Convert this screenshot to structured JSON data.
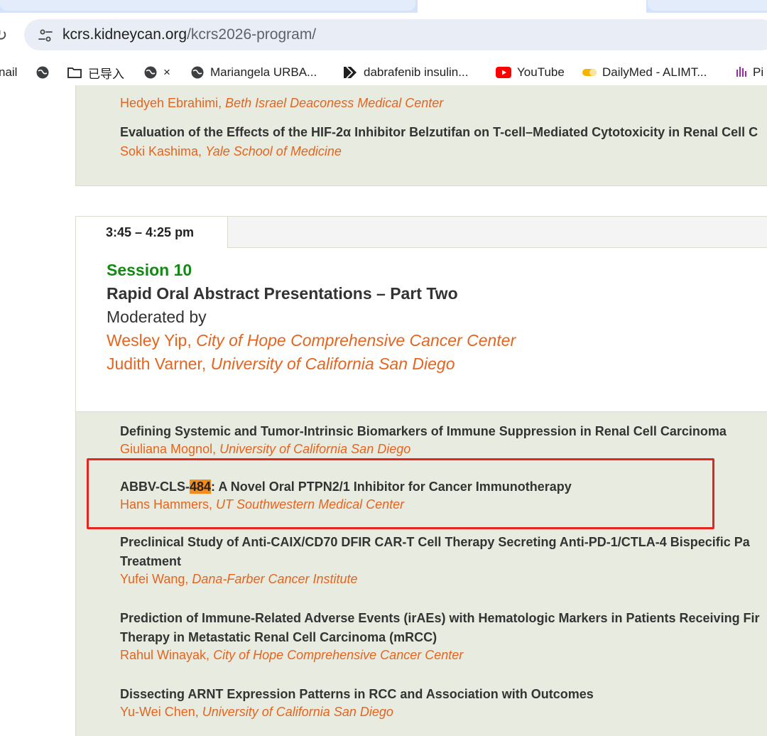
{
  "browser": {
    "url_host": "kcrs.kidneycan.org",
    "url_path": "/kcrs2026-program/",
    "bookmarks": [
      {
        "label": "nail",
        "icon": "gmail-icon"
      },
      {
        "label": "",
        "icon": "globe-icon"
      },
      {
        "label": "已导入",
        "icon": "folder-icon"
      },
      {
        "label": "×",
        "icon": "globe-icon"
      },
      {
        "label": "Mariangela URBA...",
        "icon": "globe-icon"
      },
      {
        "label": "dabrafenib insulin...",
        "icon": "bookmark-arrow-icon"
      },
      {
        "label": "YouTube",
        "icon": "youtube-icon"
      },
      {
        "label": "DailyMed - ALIMT...",
        "icon": "dailymed-icon"
      },
      {
        "label": "Pi",
        "icon": "hand-icon"
      }
    ]
  },
  "prev_session": {
    "entries": [
      {
        "title": "",
        "author": "Hedyeh Ebrahimi,",
        "institution": "Beth Israel Deaconess Medical Center"
      },
      {
        "title": "Evaluation of the Effects of the HIF-2α Inhibitor Belzutifan on T-cell–Mediated Cytotoxicity in Renal Cell C",
        "author": "Soki Kashima,",
        "institution": "Yale School of Medicine"
      }
    ]
  },
  "session": {
    "time": "3:45 – 4:25 pm",
    "label": "Session 10",
    "title": "Rapid Oral Abstract Presentations – Part Two",
    "moderated_by": "Moderated by",
    "moderators": [
      {
        "name": "Wesley Yip,",
        "institution": "City of Hope Comprehensive Cancer Center"
      },
      {
        "name": "Judith Varner,",
        "institution": "University of California San Diego"
      }
    ]
  },
  "abstracts": [
    {
      "title": "Defining Systemic and Tumor-Intrinsic Biomarkers of Immune Suppression in Renal Cell Carcinoma",
      "title2": "",
      "author": "Giuliana Mognol,",
      "institution": "University of California San Diego"
    },
    {
      "title_pre": "ABBV-CLS-",
      "title_hl": "484",
      "title_post": ": A Novel Oral PTPN2/1 Inhibitor for Cancer Immunotherapy",
      "author": "Hans Hammers,",
      "institution": "UT Southwestern Medical Center"
    },
    {
      "title": "Preclinical Study of Anti-CAIX/CD70 DFIR CAR-T Cell Therapy Secreting Anti-PD-1/CTLA-4 Bispecific Pa",
      "title2": "Treatment",
      "author": "Yufei Wang,",
      "institution": "Dana-Farber Cancer Institute"
    },
    {
      "title": "Prediction of Immune-Related Adverse Events (irAEs) with Hematologic Markers in Patients Receiving Fir",
      "title2": "Therapy in Metastatic Renal Cell Carcinoma (mRCC)",
      "author": "Rahul Winayak,",
      "institution": "City of Hope Comprehensive Cancer Center"
    },
    {
      "title": "Dissecting ARNT Expression Patterns in RCC and Association with Outcomes",
      "title2": "",
      "author": "Yu-Wei Chen,",
      "institution": "University of California San Diego"
    }
  ],
  "colors": {
    "accent_orange": "#e5641e",
    "session_green": "#148a14",
    "highlight": "#f48b1a",
    "annotation_red": "#e5251f"
  }
}
